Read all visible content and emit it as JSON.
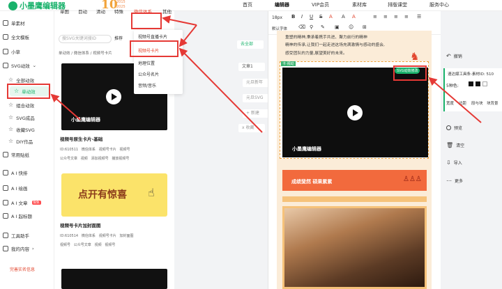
{
  "header": {
    "logo_text": "小墨鹰编辑器",
    "anniv_number": "10",
    "anniv_years": "2015\n2025",
    "nav": [
      "首页",
      "编辑器",
      "VIP会员",
      "素材库",
      "排版课堂",
      "服务中心"
    ]
  },
  "sidebar": {
    "items": [
      {
        "label": "单素材"
      },
      {
        "label": "全文模板"
      },
      {
        "label": "小草"
      },
      {
        "label": "SVG动效"
      },
      {
        "label": "全部动效"
      },
      {
        "label": "单动效"
      },
      {
        "label": "组合动效"
      },
      {
        "label": "SVG成品"
      },
      {
        "label": "收藏SVG"
      },
      {
        "label": "DIY作品"
      },
      {
        "label": "常用贴纸"
      },
      {
        "label": "A I 快排"
      },
      {
        "label": "A I 绘画"
      },
      {
        "label": "A I 文章"
      },
      {
        "label": "A I 起标题"
      },
      {
        "label": "工具助手"
      },
      {
        "label": "我的内容"
      }
    ],
    "ai_badge": "限免",
    "bottom_link": "完善实名信息"
  },
  "panel": {
    "tabs": [
      "单图",
      "目动",
      "清动",
      "特殊",
      "微信体系",
      "其他"
    ],
    "search_placeholder": "搜SVG关键词搜ID",
    "sort_label": "推荐",
    "breadcrumb": "单动效 / 微信体系 / 视频号卡片",
    "cards": [
      {
        "watermark": "小墨鹰编辑器",
        "title": "视频号原生卡片-基础",
        "tags": [
          "ID:610511",
          "微信体系",
          "视频号卡片",
          "视频号"
        ],
        "tags2": [
          "公众号文章",
          "视频",
          "添加视频号",
          "播放视频号"
        ]
      },
      {
        "banner_text": "点开有惊喜",
        "title": "视频号卡片加封面图",
        "tags": [
          "ID:610514",
          "微信体系",
          "视频号卡片",
          "加封面图"
        ],
        "tags2": [
          "视频号",
          "公众号文章",
          "视频",
          "视频号"
        ]
      }
    ]
  },
  "dropdown": {
    "items": [
      "视频号直播卡片",
      "视频号卡片",
      "地理位置",
      "公众号名片",
      "音频/音乐"
    ],
    "selected_index": 1
  },
  "middle": {
    "buttons": [
      "去全部",
      "文章1",
      "元旦新年",
      "元旦SVG",
      "+ 新建",
      "x 收藏"
    ]
  },
  "editor": {
    "toolbar": {
      "font_size": "18px",
      "font_default": "默认字体"
    },
    "doc_lines": [
      "重塑的精神,秉承着携手共进、聚力前行的精神",
      "精神的传承,让我们一起走进这场充满激情与感动的盛会,",
      "感受团队的力量,展望美好的未来。"
    ],
    "video_label": "卡·视动",
    "video_watermark": "小墨鹰编辑器",
    "svg_badge": "SVG动效修改",
    "banner_text": "成绩斐然 硕果累累"
  },
  "right_tools": {
    "items": [
      "撤销",
      "预览",
      "清空",
      "导入",
      "更多"
    ],
    "panel_title": "速达媒工具条-素材ID: 510",
    "panel_label": "5种色:",
    "panel_actions": [
      "宽度",
      "边距",
      "段与块",
      "块背景"
    ]
  },
  "colors": {
    "brand": "#19b26b",
    "accent": "#e2452d",
    "annotation": "#e53935"
  }
}
